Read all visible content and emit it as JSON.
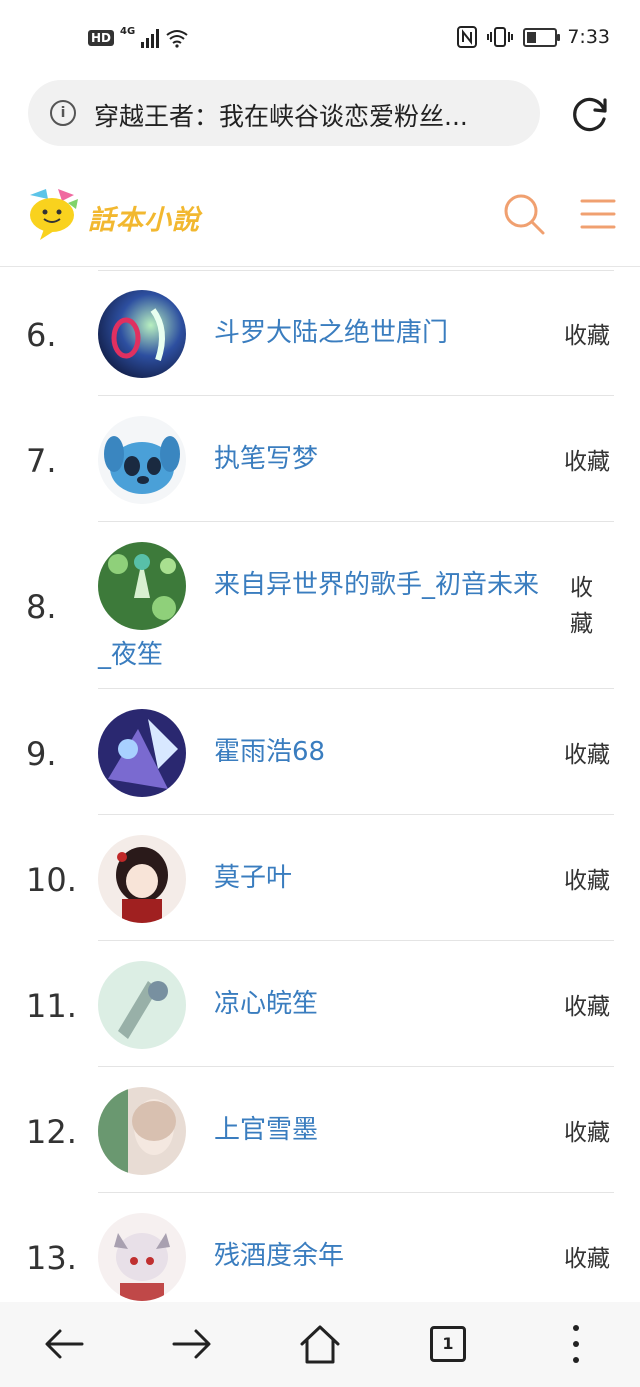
{
  "status_bar": {
    "hd": "HD",
    "network": "4G",
    "time": "7:33",
    "battery_level": 0.35
  },
  "url_bar": {
    "title": "穿越王者：我在峡谷谈恋爱粉丝..."
  },
  "site": {
    "logo_text": "話本小說",
    "brand_color": "#f2b830",
    "accent_color": "#f0a070"
  },
  "list": {
    "link_color": "#3a7dbf",
    "items": [
      {
        "rank": "6.",
        "name": "斗罗大陆之绝世唐门",
        "action": "收藏"
      },
      {
        "rank": "7.",
        "name": "执笔写梦",
        "action": "收藏"
      },
      {
        "rank": "8.",
        "name": "来自异世界的歌手_初音未来",
        "name_cont": "_夜笙",
        "action_line1": "收",
        "action_line2": "藏"
      },
      {
        "rank": "9.",
        "name": "霍雨浩68",
        "action": "收藏"
      },
      {
        "rank": "10.",
        "name": "莫子叶",
        "action": "收藏"
      },
      {
        "rank": "11.",
        "name": "凉心皖笙",
        "action": "收藏"
      },
      {
        "rank": "12.",
        "name": "上官雪墨",
        "action": "收藏"
      },
      {
        "rank": "13.",
        "name": "残酒度余年",
        "action": "收藏"
      }
    ]
  },
  "bottom_bar": {
    "tab_count": "1"
  }
}
